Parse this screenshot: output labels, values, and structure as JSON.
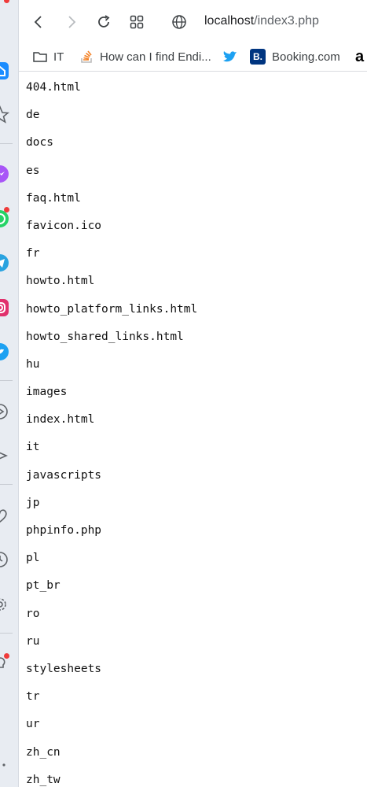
{
  "browser": {
    "address_bar": {
      "host": "localhost",
      "path": "/index3.php"
    }
  },
  "bookmarks": [
    {
      "label": "IT",
      "icon": "folder-icon"
    },
    {
      "label": "How can I find Endi...",
      "icon": "stackoverflow-icon"
    },
    {
      "label": "",
      "icon": "twitter-bird-icon"
    },
    {
      "label": "Booking.com",
      "icon": "booking-icon",
      "icon_text": "B."
    },
    {
      "label": "",
      "icon": "amazon-icon",
      "icon_text": "a"
    }
  ],
  "listing": [
    "404.html",
    "de",
    "docs",
    "es",
    "faq.html",
    "favicon.ico",
    "fr",
    "howto.html",
    "howto_platform_links.html",
    "howto_shared_links.html",
    "hu",
    "images",
    "index.html",
    "it",
    "javascripts",
    "jp",
    "phpinfo.php",
    "pl",
    "pt_br",
    "ro",
    "ru",
    "stylesheets",
    "tr",
    "ur",
    "zh_cn",
    "zh_tw"
  ],
  "colors": {
    "rail_background": "#e8ecf2",
    "rail_active": "#1a8cff",
    "messenger": "#a855f7",
    "whatsapp": "#25d366",
    "telegram": "#2aa3e0",
    "instagram": "#e1306c",
    "notification_dot": "#ef3b3b",
    "booking": "#003580",
    "twitter": "#1da1f2",
    "stackoverflow": "#f48024"
  }
}
